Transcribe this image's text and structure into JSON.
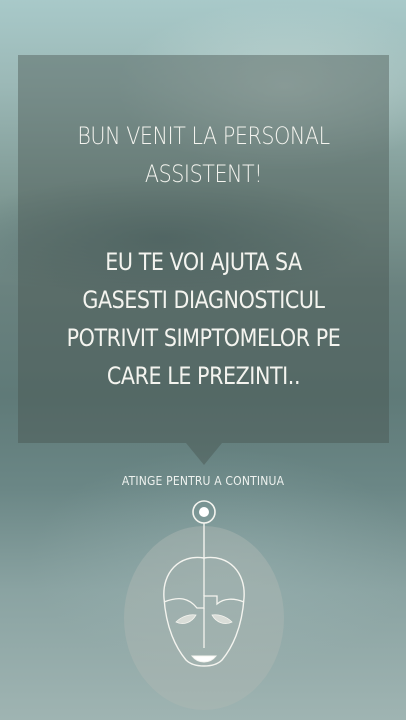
{
  "message": {
    "welcome": "BUN VENIT LA PERSONAL ASSISTENT!",
    "intro": "EU TE VOI AJUTA SA GASESTI DIAGNOSTICUL POTRIVIT SIMPTOMELOR PE CARE LE PREZINTI.."
  },
  "action": {
    "tap_hint": "ATINGE PENTRU A CONTINUA",
    "avatar_icon": "robot-face-icon"
  },
  "colors": {
    "text": "#f4f4ef",
    "box": "rgba(70,80,76,0.42)"
  }
}
